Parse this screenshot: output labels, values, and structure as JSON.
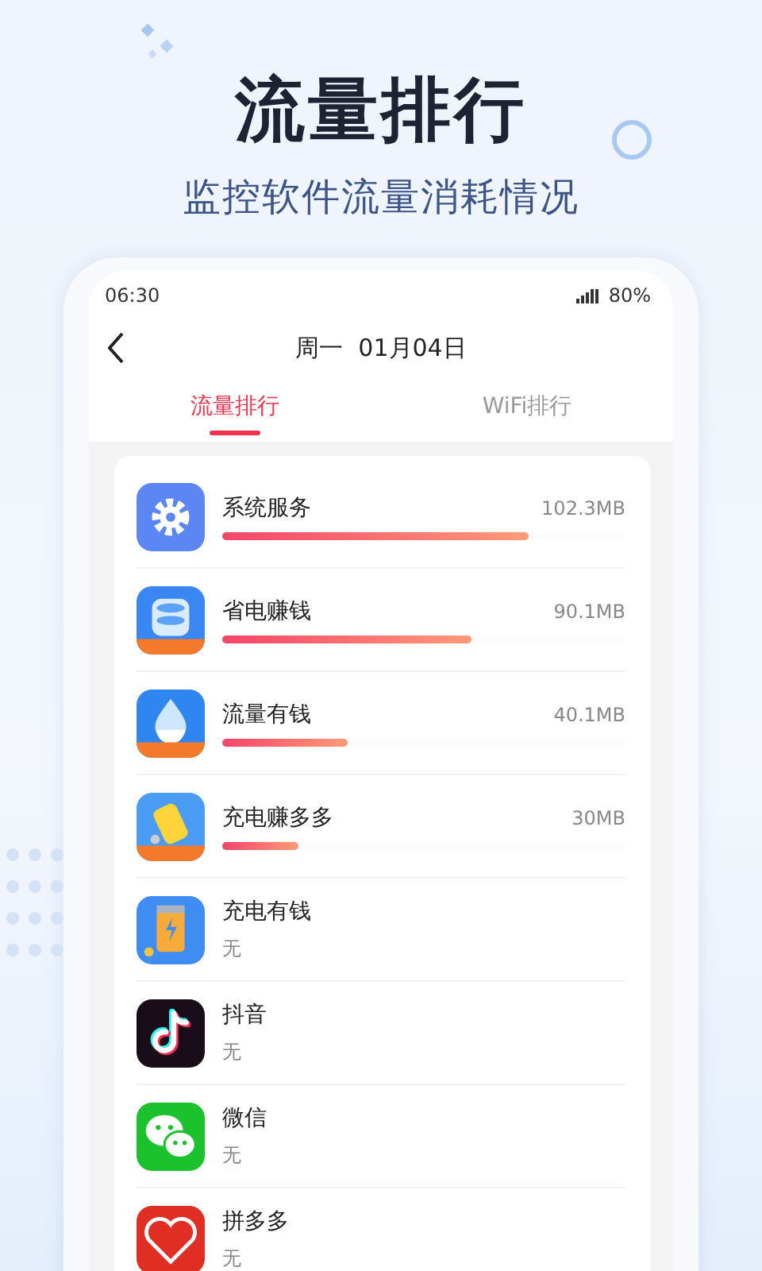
{
  "headline": "流量排行",
  "subtitle": "监控软件流量消耗情况",
  "status_bar": {
    "time": "06:30",
    "battery": "80%"
  },
  "header": {
    "title": "周一  01月04日"
  },
  "tabs": [
    {
      "label": "流量排行",
      "selected": true
    },
    {
      "label": "WiFi排行",
      "selected": false
    }
  ],
  "apps": [
    {
      "name": "系统服务",
      "kind": "bar",
      "usage": "102.3MB",
      "level": 0.76
    },
    {
      "name": "省电赚钱",
      "kind": "bar",
      "usage": "90.1MB",
      "level": 0.62
    },
    {
      "name": "流量有钱",
      "kind": "bar",
      "usage": "40.1MB",
      "level": 0.31
    },
    {
      "name": "充电赚多多",
      "kind": "bar",
      "usage": "30MB",
      "level": 0.19
    },
    {
      "name": "充电有钱",
      "kind": "text",
      "usage": "无"
    },
    {
      "name": "抖音",
      "kind": "text",
      "usage": "无"
    },
    {
      "name": "微信",
      "kind": "text",
      "usage": "无"
    },
    {
      "name": "拼多多",
      "kind": "text",
      "usage": "无"
    }
  ]
}
